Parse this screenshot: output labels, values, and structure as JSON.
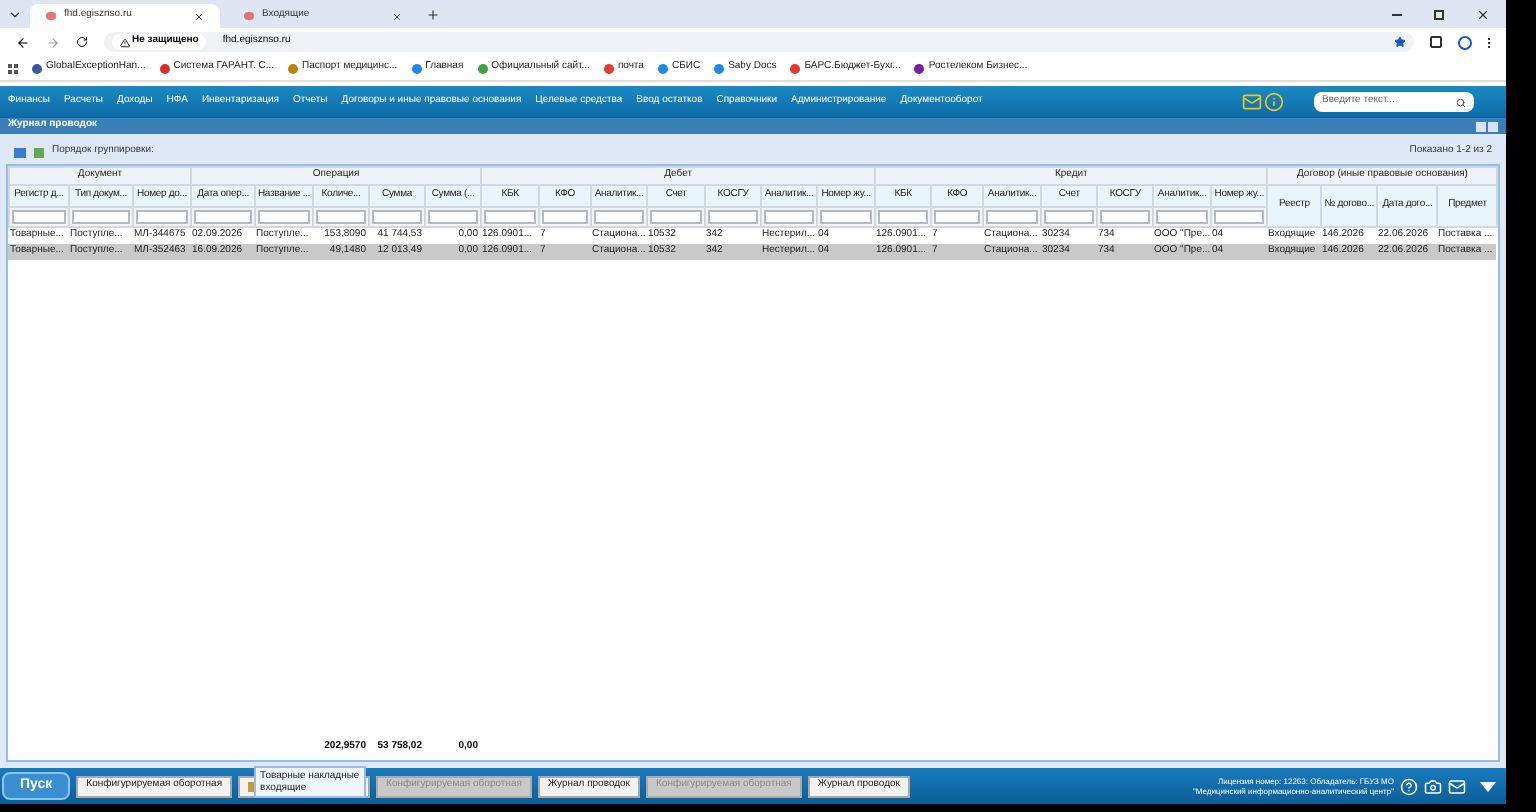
{
  "browser": {
    "tabs": [
      {
        "title": "fhd.egisznso.ru",
        "selected": true
      },
      {
        "title": "Входящие",
        "selected": false
      }
    ],
    "address": {
      "security": "Не защищено",
      "url": "fhd.egisznso.ru"
    },
    "bookmarks": [
      "GlobalExceptionHan...",
      "Система ГАРАНТ. С...",
      "Паспорт медицинс...",
      "Главная",
      "Официальный сайт...",
      "почта",
      "СБИС",
      "Saby Docs",
      "БАРС.Бюджет-Бухг...",
      "Ростелеком Бизнес..."
    ]
  },
  "menu": {
    "items": [
      "Финансы",
      "Расчеты",
      "Доходы",
      "НФА",
      "Инвентаризация",
      "Отчеты",
      "Договоры и иные правовые основания",
      "Целевые средства",
      "Ввод остатков",
      "Справочники",
      "Администрирование",
      "Документооборот"
    ],
    "search": {
      "placeholder": "Введите текст..."
    }
  },
  "panel": {
    "title": "Журнал проводок",
    "grouping_label": "Порядок группировки:",
    "shown": "Показано 1-2 из 2"
  },
  "table": {
    "groups": [
      {
        "label": "Документ",
        "filters": true,
        "columns": [
          "Регистр д...",
          "Тип докум...",
          "Номер до..."
        ]
      },
      {
        "label": "Операция",
        "filters": true,
        "columns": [
          "Дата опер...",
          "Название ...",
          "Количе...",
          "Сумма",
          "Сумма (..."
        ]
      },
      {
        "label": "Дебет",
        "filters": true,
        "columns": [
          "КБК",
          "КФО",
          "Аналитик...",
          "Счет",
          "КОСГУ",
          "Аналитик...",
          "Номер жу..."
        ]
      },
      {
        "label": "Кредит",
        "filters": true,
        "columns": [
          "КБК",
          "КФО",
          "Аналитик...",
          "Счет",
          "КОСГУ",
          "Аналитик...",
          "Номер жу..."
        ]
      },
      {
        "label": "Договор (иные правовые основания)",
        "filters": false,
        "columns": [
          "Реестр",
          "№ догово...",
          "Дата дого...",
          "Предмет"
        ]
      }
    ],
    "rows": [
      {
        "selected": false,
        "cells": [
          "Товарные...",
          "Поступле...",
          "МЛ-344675",
          "02.09.2026",
          "Поступле...",
          "153,8090",
          "41 744,53",
          "0,00",
          "126.0901...",
          "7",
          "Стациона...",
          "10532",
          "342",
          "Нестерил...",
          "04",
          "126.0901...",
          "7",
          "Стациона...",
          "30234",
          "734",
          "ООО \"Пре...",
          "04",
          "Входящие",
          "146.2026",
          "22.06.2026",
          "Поставка ..."
        ]
      },
      {
        "selected": true,
        "cells": [
          "Товарные...",
          "Поступле...",
          "МЛ-352463",
          "16.09.2026",
          "Поступле...",
          "49,1480",
          "12 013,49",
          "0,00",
          "126.0901...",
          "7",
          "Стациона...",
          "10532",
          "342",
          "Нестерил...",
          "04",
          "126.0901...",
          "7",
          "Стациона...",
          "30234",
          "734",
          "ООО \"Пре...",
          "04",
          "Входящие",
          "146.2026",
          "22.06.2026",
          "Поставка ..."
        ]
      }
    ],
    "totals": {
      "quantity": "202,9570",
      "sum": "53 758,02",
      "sum_2": "0,00"
    }
  },
  "taskbar": {
    "start": "Пуск",
    "items": [
      {
        "label": "Конфигурируемая оборотная",
        "disabled": false
      },
      {
        "kind": "icon",
        "disabled": false
      },
      {
        "label": "Конфигурируемая оборотная",
        "disabled": true
      },
      {
        "label": "Журнал проводок",
        "disabled": false
      },
      {
        "label": "Конфигурируемая оборотная",
        "disabled": true
      },
      {
        "label": "Журнал проводок",
        "disabled": false
      }
    ],
    "tooltip": "Товарные накладные входящие",
    "license": "Лицензия номер: 12263: Обладатель: ГБУЗ МО \"Медицинский информационно-аналитический центр\""
  }
}
